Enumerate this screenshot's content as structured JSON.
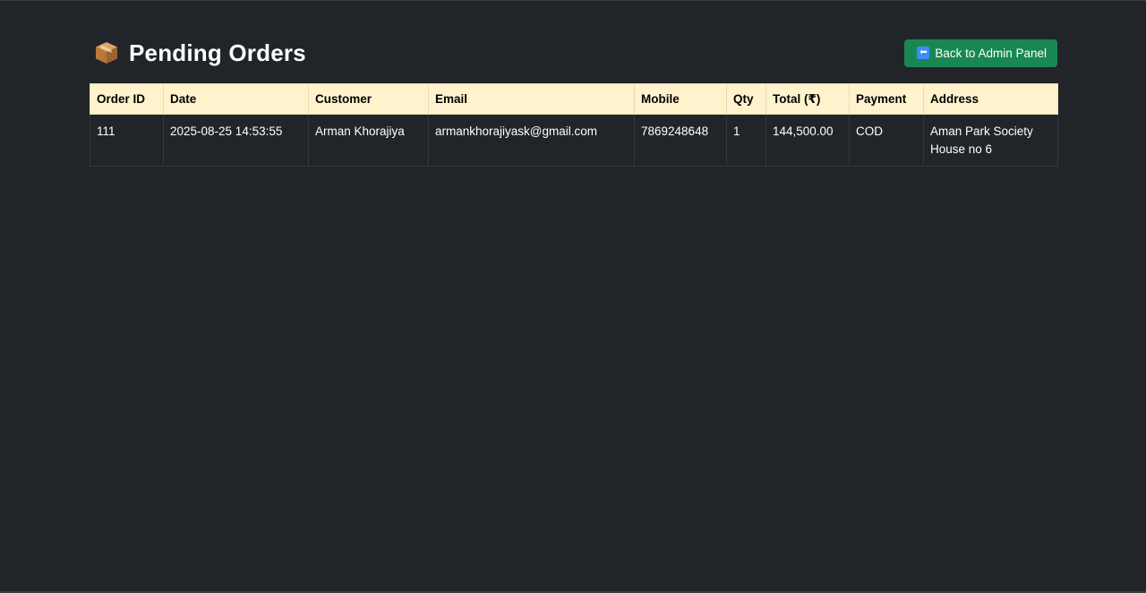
{
  "page": {
    "title": "Pending Orders",
    "title_icon": "package-box-icon"
  },
  "actions": {
    "back_label": "Back to Admin Panel",
    "back_icon": "left-arrow-icon"
  },
  "table": {
    "columns": [
      "Order ID",
      "Date",
      "Customer",
      "Email",
      "Mobile",
      "Qty",
      "Total (₹)",
      "Payment",
      "Address"
    ],
    "rows": [
      {
        "order_id": "111",
        "date": "2025-08-25 14:53:55",
        "customer": "Arman Khorajiya",
        "email": "armankhorajiyask@gmail.com",
        "mobile": "7869248648",
        "qty": "1",
        "total": "144,500.00",
        "payment": "COD",
        "address": "Aman Park Society House no 6"
      }
    ]
  },
  "colors": {
    "background": "#212529",
    "header_row": "#fff3cd",
    "button": "#198754"
  }
}
